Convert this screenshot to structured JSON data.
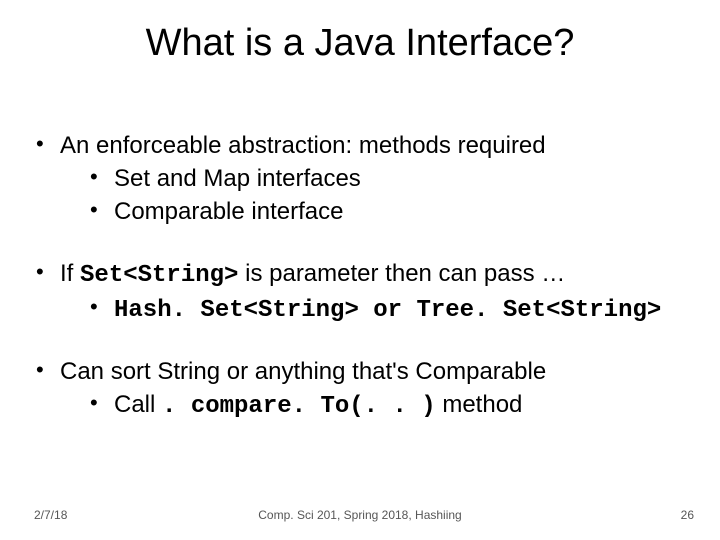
{
  "title": "What is a Java Interface?",
  "bullets": {
    "b1": {
      "text": "An enforceable abstraction: methods required",
      "sub1": "Set and Map interfaces",
      "sub2": "Comparable interface"
    },
    "b2": {
      "prefix": "If ",
      "code": "Set<String>",
      "suffix": " is parameter then can pass …",
      "sub1_code": "Hash. Set<String> or Tree. Set<String>"
    },
    "b3": {
      "text": "Can sort String or anything that's Comparable",
      "sub1_prefix": "Call ",
      "sub1_code": ". compare. To(. . )",
      "sub1_suffix": " method"
    }
  },
  "footer": {
    "date": "2/7/18",
    "course": "Comp. Sci 201, Spring 2018,  Hashiing",
    "slide_num": "26"
  }
}
